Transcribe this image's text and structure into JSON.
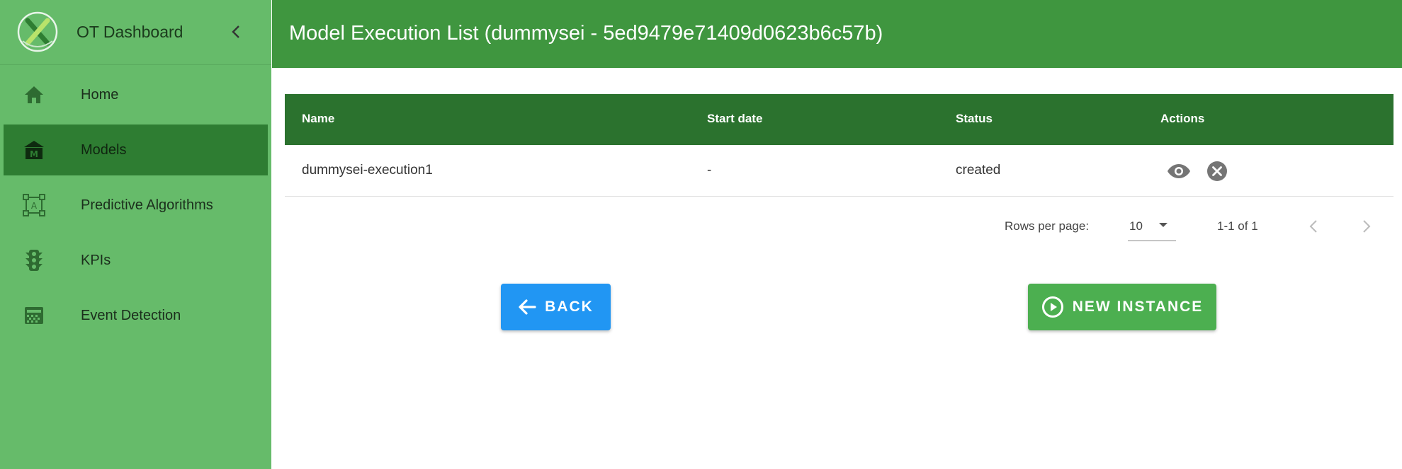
{
  "app": {
    "title": "OT Dashboard",
    "logo_icon": "x-logo-icon",
    "collapse_icon": "chevron-left-icon"
  },
  "sidebar": {
    "items": [
      {
        "label": "Home",
        "icon": "home-icon",
        "active": false
      },
      {
        "label": "Models",
        "icon": "models-icon",
        "active": true
      },
      {
        "label": "Predictive Algorithms",
        "icon": "algorithm-icon",
        "active": false
      },
      {
        "label": "KPIs",
        "icon": "traffic-light-icon",
        "active": false
      },
      {
        "label": "Event Detection",
        "icon": "event-detection-icon",
        "active": false
      }
    ]
  },
  "header": {
    "title": "Model Execution List (dummysei - 5ed9479e71409d0623b6c57b)"
  },
  "table": {
    "columns": [
      "Name",
      "Start date",
      "Status",
      "Actions"
    ],
    "rows": [
      {
        "name": "dummysei-execution1",
        "start_date": "-",
        "status": "created",
        "actions": [
          "view-icon",
          "delete-icon"
        ]
      }
    ]
  },
  "pagination": {
    "rows_per_page_label": "Rows per page:",
    "rows_per_page_value": "10",
    "range": "1-1 of 1"
  },
  "buttons": {
    "back_label": "BACK",
    "new_instance_label": "NEW INSTANCE"
  },
  "colors": {
    "sidebar": "#66bb6a",
    "sidebar_active": "#2e7d32",
    "header": "#3f963f",
    "table_header": "#2b722e",
    "back_button": "#2196f3",
    "new_instance_button": "#4caf50"
  }
}
